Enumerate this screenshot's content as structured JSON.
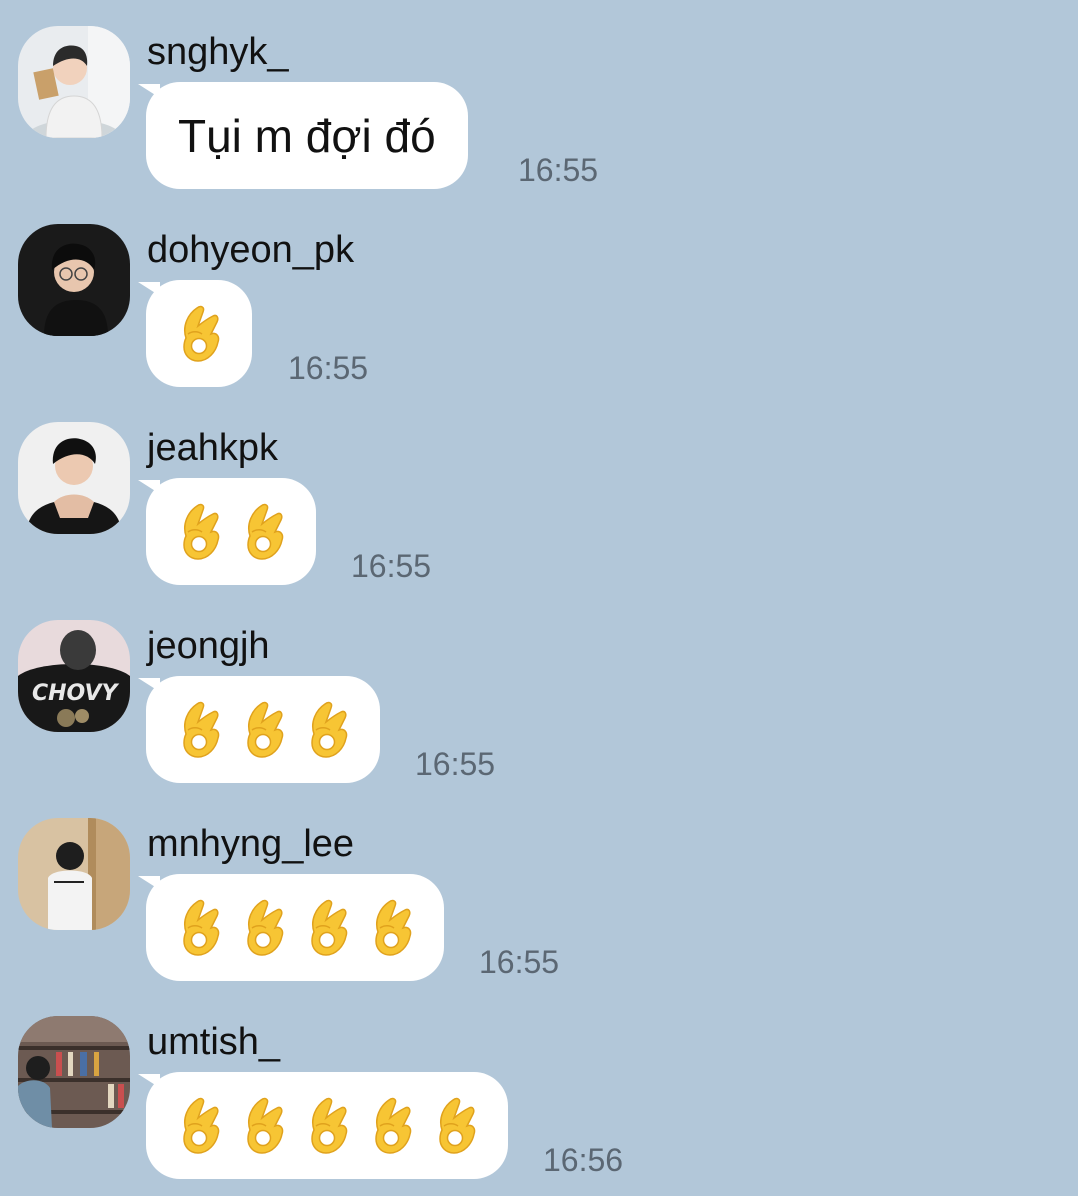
{
  "messages": [
    {
      "sender": "snghyk_",
      "text": "Tụi m đợi đó",
      "ok_count": 0,
      "time": "16:55",
      "avatar": "avatar-boy-reading-book"
    },
    {
      "sender": "dohyeon_pk",
      "text": "",
      "ok_count": 1,
      "time": "16:55",
      "avatar": "avatar-boy-glasses-dark-bg"
    },
    {
      "sender": "jeahkpk",
      "text": "",
      "ok_count": 2,
      "time": "16:55",
      "avatar": "avatar-boy-hands-clasped"
    },
    {
      "sender": "jeongjh",
      "text": "",
      "ok_count": 3,
      "time": "16:55",
      "avatar": "avatar-back-chovy-shirt"
    },
    {
      "sender": "mnhyng_lee",
      "text": "",
      "ok_count": 4,
      "time": "16:55",
      "avatar": "avatar-boy-at-door"
    },
    {
      "sender": "umtish_",
      "text": "",
      "ok_count": 5,
      "time": "16:56",
      "avatar": "avatar-boy-bookshelf"
    }
  ],
  "avatar_texts": {
    "shirt_print": "CHOVY"
  },
  "emoji": "ok-hand-icon",
  "colors": {
    "background": "#b2c7d9",
    "bubble": "#ffffff",
    "time": "#5b6773",
    "emoji": "#f7c534"
  }
}
